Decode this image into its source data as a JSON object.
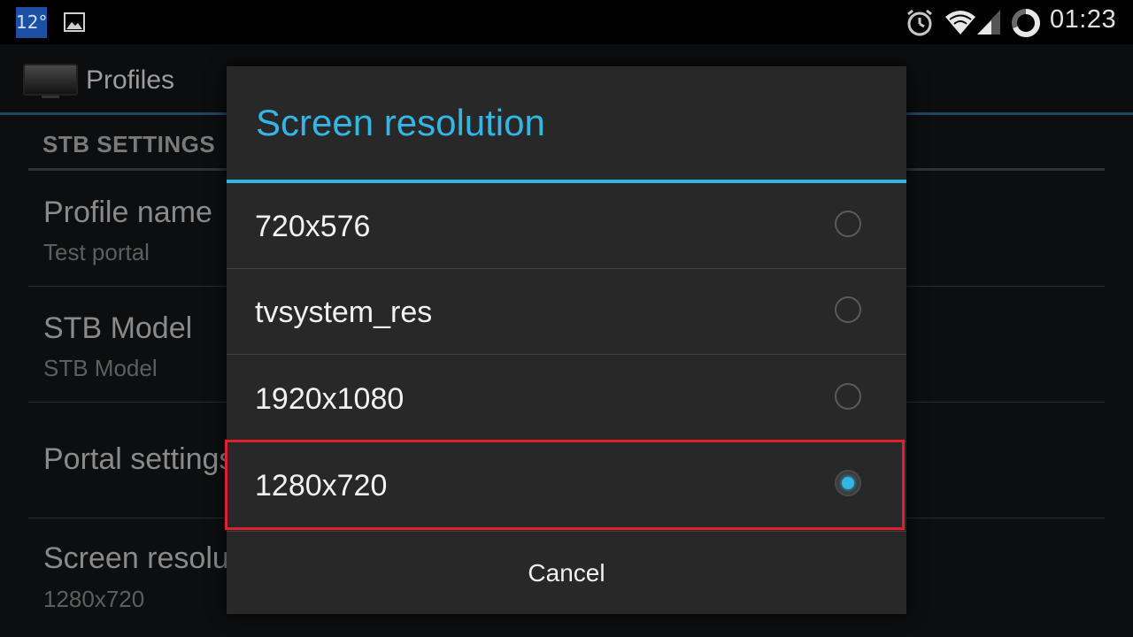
{
  "status_bar": {
    "weather_temp": "12°",
    "time": "01:23",
    "icons": [
      "gallery-icon",
      "alarm-icon",
      "wifi-icon",
      "signal-icon",
      "battery-icon"
    ]
  },
  "app_bar": {
    "title": "Profiles"
  },
  "settings": {
    "section_header": "STB SETTINGS",
    "items": [
      {
        "title": "Profile name",
        "summary": "Test portal"
      },
      {
        "title": "STB Model",
        "summary": "STB Model"
      },
      {
        "title": "Portal settings",
        "summary": ""
      },
      {
        "title": "Screen resolution",
        "summary": "1280x720"
      }
    ]
  },
  "dialog": {
    "title": "Screen resolution",
    "options": [
      {
        "label": "720x576",
        "checked": false
      },
      {
        "label": "tvsystem_res",
        "checked": false
      },
      {
        "label": "1920x1080",
        "checked": false
      },
      {
        "label": "1280x720",
        "checked": true
      }
    ],
    "cancel_label": "Cancel"
  },
  "colors": {
    "accent": "#33b5e5",
    "highlight_border": "#e0202a",
    "dialog_bg": "#282828"
  }
}
